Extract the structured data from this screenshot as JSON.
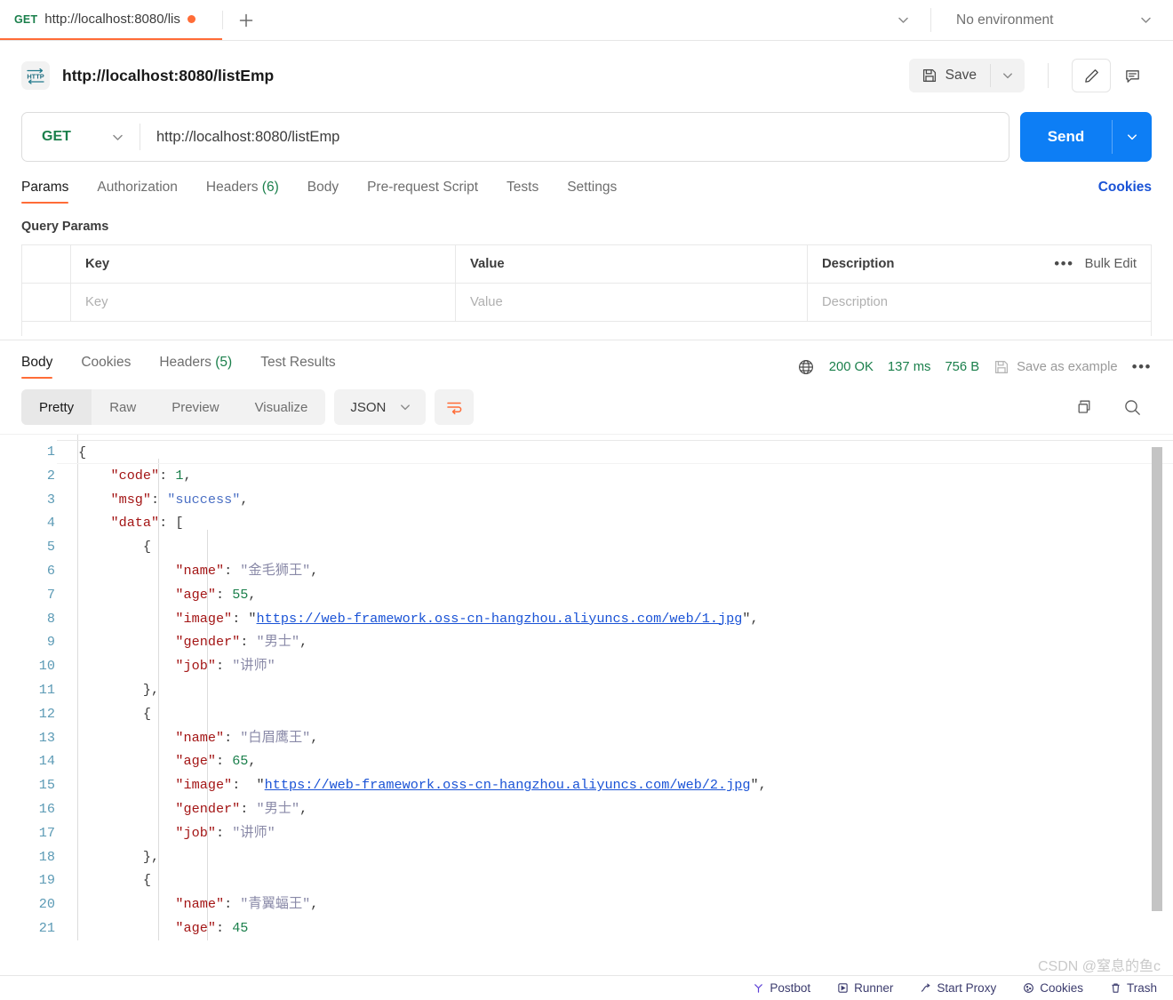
{
  "tabbar": {
    "request_tab": {
      "method": "GET",
      "name": "http://localhost:8080/lis",
      "unsaved_icon": "unsaved-dot"
    },
    "new_tab_icon": "plus-icon",
    "tabs_caret_icon": "chevron-down-icon",
    "environment": {
      "label": "No environment",
      "caret_icon": "chevron-down-icon"
    }
  },
  "request_header": {
    "protocol_badge": "HTTP",
    "title": "http://localhost:8080/listEmp",
    "save_label": "Save",
    "save_icon": "floppy-disk-icon",
    "save_caret_icon": "chevron-down-icon",
    "edit_icon": "pencil-icon",
    "comment_icon": "comment-icon"
  },
  "url_bar": {
    "method": "GET",
    "method_caret_icon": "chevron-down-icon",
    "url": "http://localhost:8080/listEmp",
    "send_label": "Send",
    "send_caret_icon": "chevron-down-icon"
  },
  "request_tabs": {
    "items": [
      {
        "label": "Params",
        "count": "",
        "active": true
      },
      {
        "label": "Authorization",
        "count": "",
        "active": false
      },
      {
        "label": "Headers",
        "count": "(6)",
        "active": false
      },
      {
        "label": "Body",
        "count": "",
        "active": false
      },
      {
        "label": "Pre-request Script",
        "count": "",
        "active": false
      },
      {
        "label": "Tests",
        "count": "",
        "active": false
      },
      {
        "label": "Settings",
        "count": "",
        "active": false
      }
    ],
    "cookies_link": "Cookies"
  },
  "query_params": {
    "section_title": "Query Params",
    "columns": [
      "Key",
      "Value",
      "Description"
    ],
    "bulk_edit_label": "Bulk Edit",
    "bulk_dots_icon": "ellipsis-icon",
    "empty_row": {
      "key_placeholder": "Key",
      "value_placeholder": "Value",
      "description_placeholder": "Description"
    }
  },
  "response": {
    "tabs": [
      {
        "label": "Body",
        "count": "",
        "active": true
      },
      {
        "label": "Cookies",
        "count": "",
        "active": false
      },
      {
        "label": "Headers",
        "count": "(5)",
        "active": false
      },
      {
        "label": "Test Results",
        "count": "",
        "active": false
      }
    ],
    "globe_icon": "globe-icon",
    "status": "200 OK",
    "time": "137 ms",
    "size": "756 B",
    "save_example_icon": "floppy-disk-icon",
    "save_example_label": "Save as example",
    "more_icon": "ellipsis-icon"
  },
  "view_toolbar": {
    "modes": [
      {
        "label": "Pretty",
        "active": true
      },
      {
        "label": "Raw",
        "active": false
      },
      {
        "label": "Preview",
        "active": false
      },
      {
        "label": "Visualize",
        "active": false
      }
    ],
    "language": "JSON",
    "language_caret_icon": "chevron-down-icon",
    "wrap_icon": "wrap-lines-icon",
    "copy_icon": "copy-icon",
    "search_icon": "search-icon"
  },
  "code_body": {
    "line_numbers": [
      1,
      2,
      3,
      4,
      5,
      6,
      7,
      8,
      9,
      10,
      11,
      12,
      13,
      14,
      15,
      16,
      17,
      18,
      19,
      20,
      21
    ],
    "lines": [
      {
        "n": 1,
        "indent": 0,
        "tokens": [
          {
            "t": "p",
            "v": "{"
          }
        ]
      },
      {
        "n": 2,
        "indent": 1,
        "tokens": [
          {
            "t": "k",
            "v": "\"code\""
          },
          {
            "t": "p",
            "v": ": "
          },
          {
            "t": "n",
            "v": "1"
          },
          {
            "t": "p",
            "v": ","
          }
        ]
      },
      {
        "n": 3,
        "indent": 1,
        "tokens": [
          {
            "t": "k",
            "v": "\"msg\""
          },
          {
            "t": "p",
            "v": ": "
          },
          {
            "t": "s",
            "v": "\"success\""
          },
          {
            "t": "p",
            "v": ","
          }
        ]
      },
      {
        "n": 4,
        "indent": 1,
        "tokens": [
          {
            "t": "k",
            "v": "\"data\""
          },
          {
            "t": "p",
            "v": ": ["
          }
        ]
      },
      {
        "n": 5,
        "indent": 2,
        "tokens": [
          {
            "t": "p",
            "v": "{"
          }
        ]
      },
      {
        "n": 6,
        "indent": 3,
        "tokens": [
          {
            "t": "k",
            "v": "\"name\""
          },
          {
            "t": "p",
            "v": ": "
          },
          {
            "t": "cn",
            "v": "\"金毛狮王\""
          },
          {
            "t": "p",
            "v": ","
          }
        ]
      },
      {
        "n": 7,
        "indent": 3,
        "tokens": [
          {
            "t": "k",
            "v": "\"age\""
          },
          {
            "t": "p",
            "v": ": "
          },
          {
            "t": "n",
            "v": "55"
          },
          {
            "t": "p",
            "v": ","
          }
        ]
      },
      {
        "n": 8,
        "indent": 3,
        "tokens": [
          {
            "t": "k",
            "v": "\"image\""
          },
          {
            "t": "p",
            "v": ": \""
          },
          {
            "t": "lnk",
            "v": "https://web-framework.oss-cn-hangzhou.aliyuncs.com/web/1.jpg"
          },
          {
            "t": "p",
            "v": "\","
          }
        ]
      },
      {
        "n": 9,
        "indent": 3,
        "tokens": [
          {
            "t": "k",
            "v": "\"gender\""
          },
          {
            "t": "p",
            "v": ": "
          },
          {
            "t": "cn",
            "v": "\"男士\""
          },
          {
            "t": "p",
            "v": ","
          }
        ]
      },
      {
        "n": 10,
        "indent": 3,
        "tokens": [
          {
            "t": "k",
            "v": "\"job\""
          },
          {
            "t": "p",
            "v": ": "
          },
          {
            "t": "cn",
            "v": "\"讲师\""
          }
        ]
      },
      {
        "n": 11,
        "indent": 2,
        "tokens": [
          {
            "t": "p",
            "v": "},"
          }
        ]
      },
      {
        "n": 12,
        "indent": 2,
        "tokens": [
          {
            "t": "p",
            "v": "{"
          }
        ]
      },
      {
        "n": 13,
        "indent": 3,
        "tokens": [
          {
            "t": "k",
            "v": "\"name\""
          },
          {
            "t": "p",
            "v": ": "
          },
          {
            "t": "cn",
            "v": "\"白眉鹰王\""
          },
          {
            "t": "p",
            "v": ","
          }
        ]
      },
      {
        "n": 14,
        "indent": 3,
        "tokens": [
          {
            "t": "k",
            "v": "\"age\""
          },
          {
            "t": "p",
            "v": ": "
          },
          {
            "t": "n",
            "v": "65"
          },
          {
            "t": "p",
            "v": ","
          }
        ]
      },
      {
        "n": 15,
        "indent": 3,
        "tokens": [
          {
            "t": "k",
            "v": "\"image\""
          },
          {
            "t": "p",
            "v": ":  \""
          },
          {
            "t": "lnk",
            "v": "https://web-framework.oss-cn-hangzhou.aliyuncs.com/web/2.jpg"
          },
          {
            "t": "p",
            "v": "\","
          }
        ]
      },
      {
        "n": 16,
        "indent": 3,
        "tokens": [
          {
            "t": "k",
            "v": "\"gender\""
          },
          {
            "t": "p",
            "v": ": "
          },
          {
            "t": "cn",
            "v": "\"男士\""
          },
          {
            "t": "p",
            "v": ","
          }
        ]
      },
      {
        "n": 17,
        "indent": 3,
        "tokens": [
          {
            "t": "k",
            "v": "\"job\""
          },
          {
            "t": "p",
            "v": ": "
          },
          {
            "t": "cn",
            "v": "\"讲师\""
          }
        ]
      },
      {
        "n": 18,
        "indent": 2,
        "tokens": [
          {
            "t": "p",
            "v": "},"
          }
        ]
      },
      {
        "n": 19,
        "indent": 2,
        "tokens": [
          {
            "t": "p",
            "v": "{"
          }
        ]
      },
      {
        "n": 20,
        "indent": 3,
        "tokens": [
          {
            "t": "k",
            "v": "\"name\""
          },
          {
            "t": "p",
            "v": ": "
          },
          {
            "t": "cn",
            "v": "\"青翼蝠王\""
          },
          {
            "t": "p",
            "v": ","
          }
        ]
      },
      {
        "n": 21,
        "indent": 3,
        "tokens": [
          {
            "t": "k",
            "v": "\"age\""
          },
          {
            "t": "p",
            "v": ": "
          },
          {
            "t": "n",
            "v": "45"
          }
        ]
      }
    ]
  },
  "bottom_bar": {
    "items": [
      {
        "label": "Postbot",
        "icon": "postbot-icon"
      },
      {
        "label": "Runner",
        "icon": "runner-icon"
      },
      {
        "label": "Start Proxy",
        "icon": "proxy-icon"
      },
      {
        "label": "Cookies",
        "icon": "cookies-icon"
      },
      {
        "label": "Trash",
        "icon": "trash-icon"
      }
    ]
  },
  "watermark": {
    "text": "CSDN @窒息的鱼c"
  },
  "colors": {
    "accent_orange": "#ff6c37",
    "send_blue": "#0d7ef5",
    "link_blue": "#1a53d6",
    "success_green": "#1a7f4b"
  }
}
